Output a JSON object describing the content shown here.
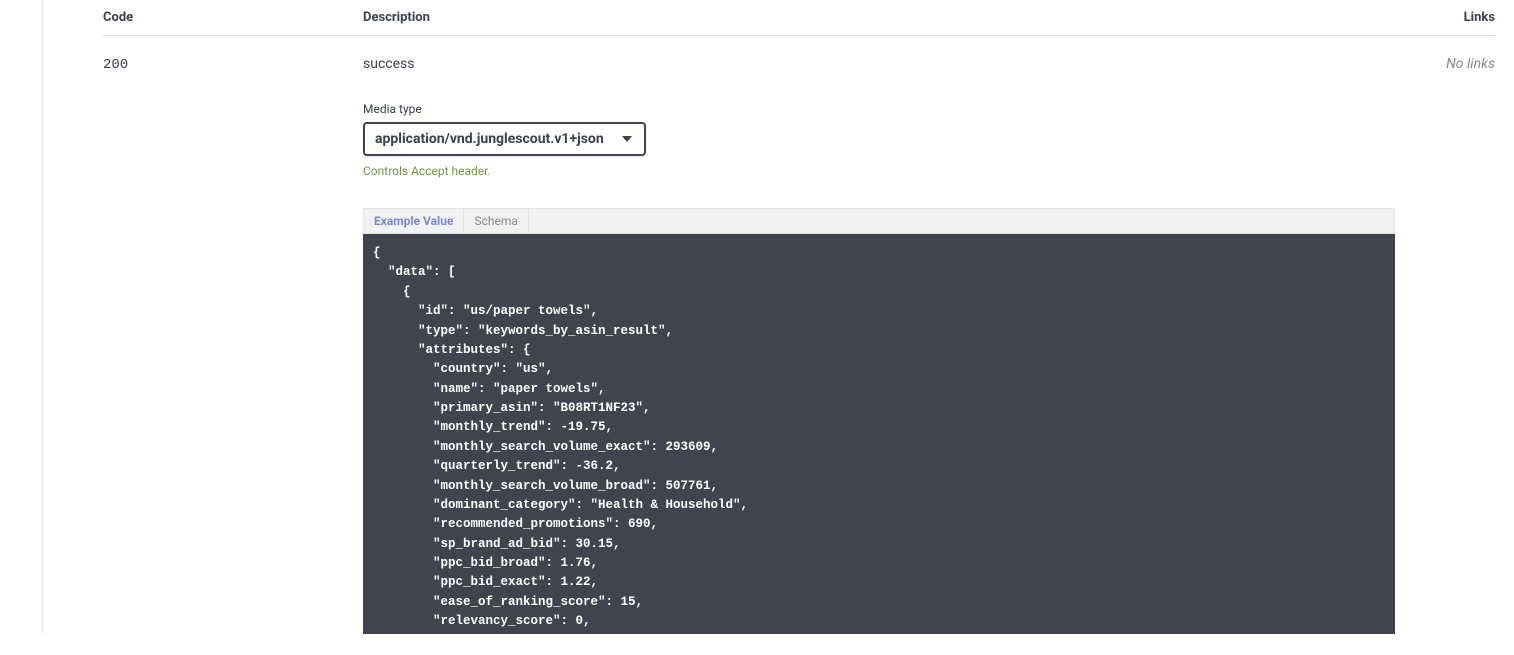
{
  "headers": {
    "code": "Code",
    "description": "Description",
    "links": "Links"
  },
  "response": {
    "code": "200",
    "description": "success",
    "no_links": "No links",
    "media_type_label": "Media type",
    "media_type_value": "application/vnd.junglescout.v1+json",
    "accept_hint": "Controls Accept header.",
    "tabs": {
      "example_value": "Example Value",
      "schema": "Schema"
    },
    "example_body": "{\n  \"data\": [\n    {\n      \"id\": \"us/paper towels\",\n      \"type\": \"keywords_by_asin_result\",\n      \"attributes\": {\n        \"country\": \"us\",\n        \"name\": \"paper towels\",\n        \"primary_asin\": \"B08RT1NF23\",\n        \"monthly_trend\": -19.75,\n        \"monthly_search_volume_exact\": 293609,\n        \"quarterly_trend\": -36.2,\n        \"monthly_search_volume_broad\": 507761,\n        \"dominant_category\": \"Health & Household\",\n        \"recommended_promotions\": 690,\n        \"sp_brand_ad_bid\": 30.15,\n        \"ppc_bid_broad\": 1.76,\n        \"ppc_bid_exact\": 1.22,\n        \"ease_of_ranking_score\": 15,\n        \"relevancy_score\": 0,"
  }
}
